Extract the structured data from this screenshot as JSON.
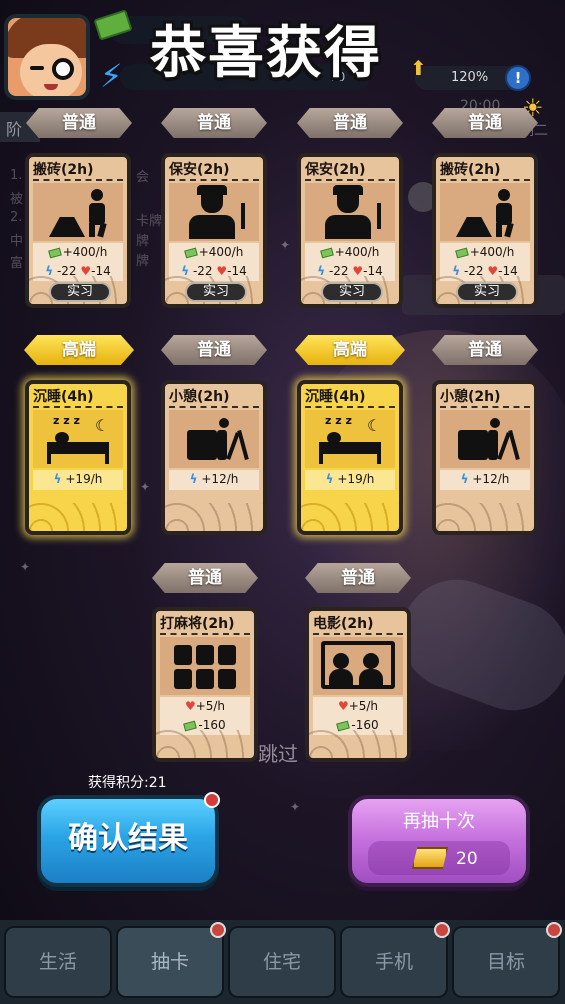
{
  "header": {
    "title": "恭喜获得",
    "percent": "120%",
    "energy_value": "00",
    "stage_label": "阶",
    "weekday": "期二",
    "time_text": "20:00"
  },
  "faded_text": {
    "l1": "1.",
    "l2": "被",
    "l3": "2.",
    "l4": "中",
    "l5": "富",
    "m1": "会",
    "m2": "卡牌",
    "m3": "牌",
    "m4": "牌"
  },
  "tags": {
    "common": "普通",
    "high": "高端"
  },
  "cards": [
    {
      "title": "搬砖(2h)",
      "rarity": "common",
      "money": "+400/h",
      "energy": "-22",
      "health": "-14",
      "badge": "实习"
    },
    {
      "title": "保安(2h)",
      "rarity": "common",
      "money": "+400/h",
      "energy": "-22",
      "health": "-14",
      "badge": "实习"
    },
    {
      "title": "保安(2h)",
      "rarity": "common",
      "money": "+400/h",
      "energy": "-22",
      "health": "-14",
      "badge": "实习"
    },
    {
      "title": "搬砖(2h)",
      "rarity": "common",
      "money": "+400/h",
      "energy": "-22",
      "health": "-14",
      "badge": "实习"
    },
    {
      "title": "沉睡(4h)",
      "rarity": "high",
      "energy": "+19/h"
    },
    {
      "title": "小憩(2h)",
      "rarity": "common",
      "energy": "+12/h"
    },
    {
      "title": "沉睡(4h)",
      "rarity": "high",
      "energy": "+19/h"
    },
    {
      "title": "小憩(2h)",
      "rarity": "common",
      "energy": "+12/h"
    },
    {
      "title": "打麻将(2h)",
      "rarity": "common",
      "health": "+5/h",
      "money": "-160"
    },
    {
      "title": "电影(2h)",
      "rarity": "common",
      "health": "+5/h",
      "money": "-160"
    }
  ],
  "footer": {
    "skip": "跳过",
    "score": "获得积分:21",
    "confirm": "确认结果",
    "again": "再抽十次",
    "again_cost": "20"
  },
  "nav": {
    "items": [
      "生活",
      "抽卡",
      "住宅",
      "手机",
      "目标"
    ],
    "active": "抽卡"
  },
  "colors": {
    "common_tag": "#9c8c82",
    "high_tag": "#f5cc2a",
    "confirm_button": "#2aa4e6",
    "again_button": "#c46fdc",
    "card_bg": "#e8c49d",
    "card_gold_bg": "#f7d449"
  }
}
